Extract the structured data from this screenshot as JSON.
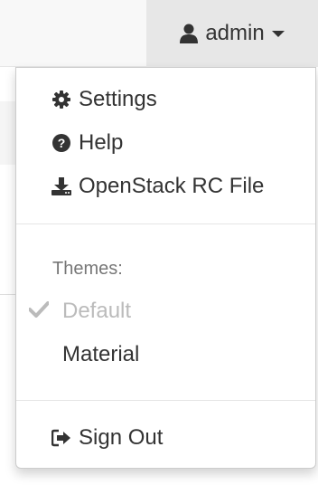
{
  "navbar": {
    "user": {
      "icon": "user-icon",
      "label": "admin",
      "caret_icon": "caret-down-icon"
    }
  },
  "menu": {
    "items": [
      {
        "icon": "cog-icon",
        "label": "Settings"
      },
      {
        "icon": "question-circle-icon",
        "label": "Help"
      },
      {
        "icon": "download-icon",
        "label": "OpenStack RC File"
      }
    ],
    "themes_header": "Themes:",
    "themes": [
      {
        "label": "Default",
        "selected": true,
        "icon": "check-icon"
      },
      {
        "label": "Material",
        "selected": false
      }
    ],
    "sign_out": {
      "icon": "sign-out-icon",
      "label": "Sign Out"
    }
  },
  "colors": {
    "navbar_bg": "#f8f8f8",
    "toggle_bg": "#e7e7e7",
    "text": "#333333",
    "muted": "#777777",
    "disabled": "#bbbbbb"
  }
}
